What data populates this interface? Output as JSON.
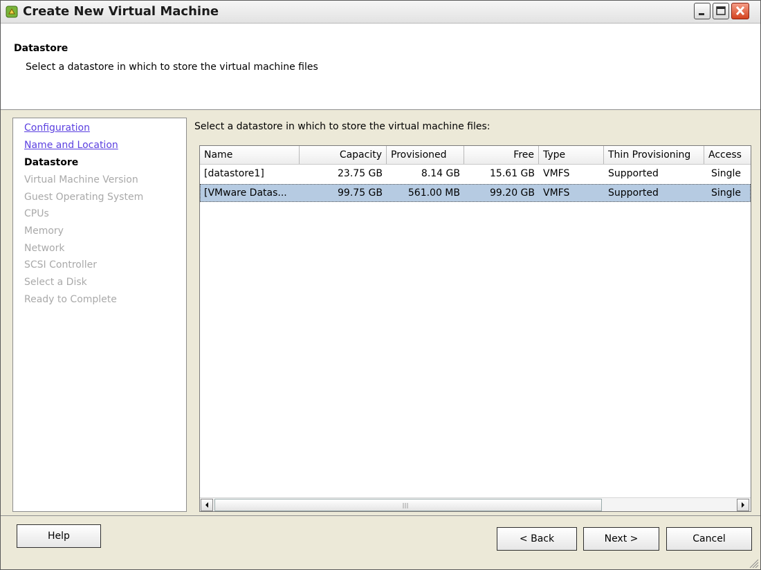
{
  "window": {
    "title": "Create New Virtual Machine",
    "controls": [
      "minimize-icon",
      "maximize-icon",
      "close-icon"
    ]
  },
  "header": {
    "title": "Datastore",
    "subtitle": "Select a datastore in which to store the virtual machine files"
  },
  "steps": [
    {
      "label": "Configuration",
      "state": "completed"
    },
    {
      "label": "Name and Location",
      "state": "completed"
    },
    {
      "label": "Datastore",
      "state": "current"
    },
    {
      "label": "Virtual Machine Version",
      "state": "pending"
    },
    {
      "label": "Guest Operating System",
      "state": "pending"
    },
    {
      "label": "CPUs",
      "state": "pending"
    },
    {
      "label": "Memory",
      "state": "pending"
    },
    {
      "label": "Network",
      "state": "pending"
    },
    {
      "label": "SCSI Controller",
      "state": "pending"
    },
    {
      "label": "Select a Disk",
      "state": "pending"
    },
    {
      "label": "Ready to Complete",
      "state": "pending"
    }
  ],
  "content": {
    "instruction": "Select a datastore in which to store the virtual machine files:"
  },
  "table": {
    "columns": [
      "Name",
      "Capacity",
      "Provisioned",
      "Free",
      "Type",
      "Thin Provisioning",
      "Access"
    ],
    "rows": [
      {
        "name": "[datastore1]",
        "capacity": "23.75 GB",
        "provisioned": "8.14 GB",
        "free": "15.61 GB",
        "type": "VMFS",
        "thin": "Supported",
        "access": "Single"
      },
      {
        "name": "[VMware Datas...",
        "capacity": "99.75 GB",
        "provisioned": "561.00 MB",
        "free": "99.20 GB",
        "type": "VMFS",
        "thin": "Supported",
        "access": "Single",
        "selected": true
      }
    ]
  },
  "buttons": {
    "help": "Help",
    "back": "< Back",
    "next": "Next >",
    "cancel": "Cancel"
  },
  "colors": {
    "selection": "#b6cbe2",
    "link": "#5a3fe0",
    "disabled_text": "#a9a9a9",
    "close_button": "#d3431f"
  }
}
